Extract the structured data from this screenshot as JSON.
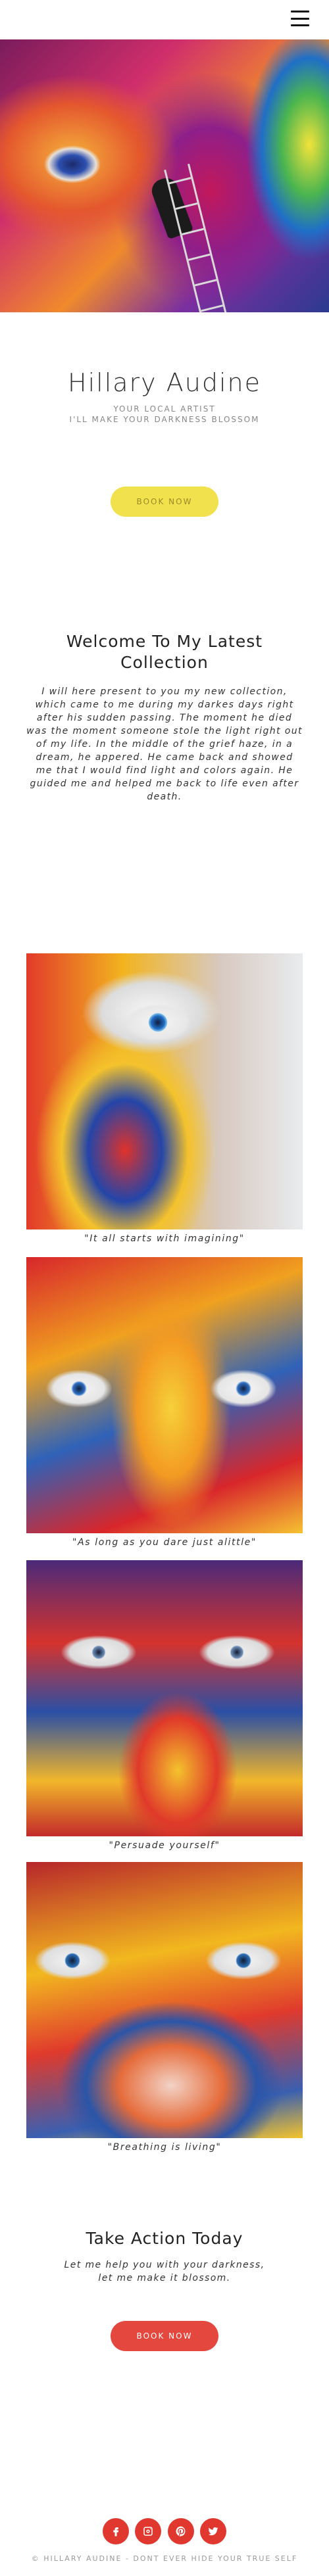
{
  "nav": {
    "menu_icon": "hamburger-menu-icon"
  },
  "hero": {
    "title": "Hillary Audine",
    "subtitle_line1": "YOUR LOCAL ARTIST",
    "subtitle_line2": "I'LL MAKE YOUR DARKNESS BLOSSOM",
    "button_label": "BOOK NOW",
    "button_color": "#f1e14c"
  },
  "welcome": {
    "title_line1": "Welcome To My Latest",
    "title_line2": "Collection",
    "paragraph": "I will here present to you my new collection, which came to me during my darkes days right after his sudden passing. The moment he died was the moment someone stole the light right out of my life. In the middle of the grief haze, in a dream, he appered. He came back and showed me that I would find light and colors again. He guided me and helped me back to life even after death."
  },
  "gallery": [
    {
      "caption": "\"It all starts with imagining\""
    },
    {
      "caption": "\"As long as you dare just alittle\""
    },
    {
      "caption": "\"Persuade yourself\""
    },
    {
      "caption": "\"Breathing is living\""
    }
  ],
  "action": {
    "title": "Take Action Today",
    "line1": "Let me help you with your darkness,",
    "line2": "let me make it blossom.",
    "button_label": "BOOK NOW",
    "button_color": "#e3473d"
  },
  "social": {
    "icons": [
      "facebook-icon",
      "instagram-icon",
      "pinterest-icon",
      "twitter-icon"
    ],
    "color": "#e0382f"
  },
  "footer": {
    "text": "© HILLARY AUDINE - DONT EVER HIDE YOUR TRUE SELF"
  }
}
